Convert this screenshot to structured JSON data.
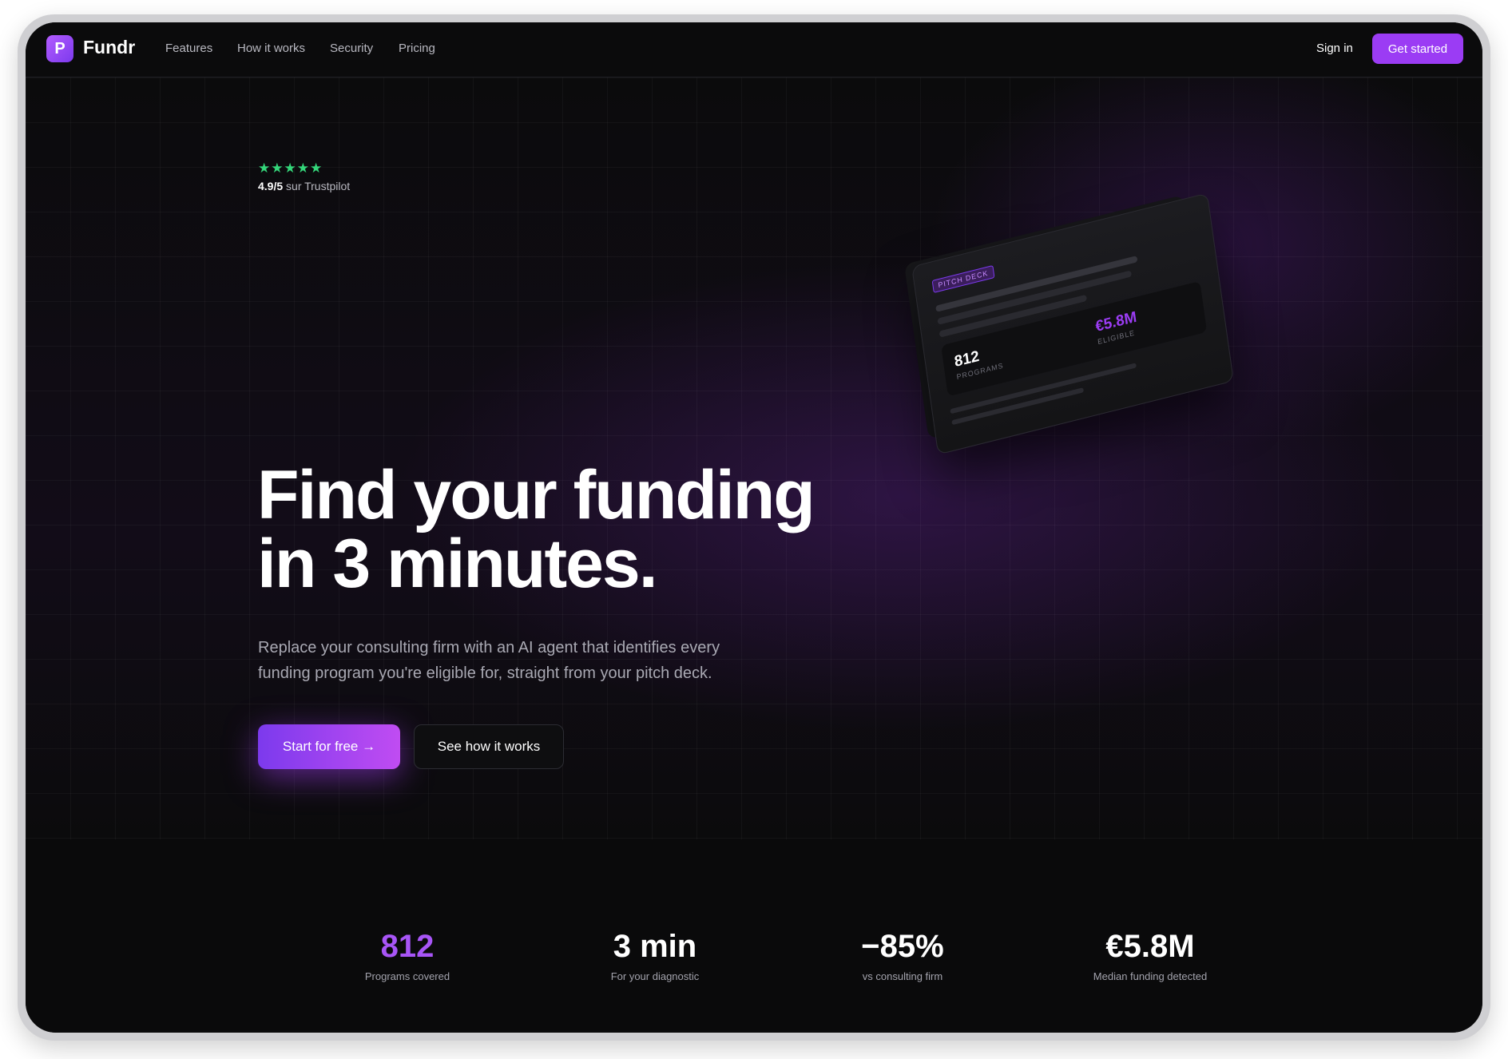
{
  "brand": {
    "mark": "P",
    "name": "Fundr",
    "accent": "#9b3cf4"
  },
  "nav": {
    "links": [
      "Features",
      "How it works",
      "Security",
      "Pricing"
    ],
    "signin": "Sign in",
    "cta": "Get started"
  },
  "rating": {
    "stars": "★★★★★",
    "score": "4.9/5",
    "source": "sur Trustpilot",
    "star_color": "#34d67a"
  },
  "hero": {
    "title_line1": "Find your funding",
    "title_line2": "in 3 minutes.",
    "subtitle": "Replace your consulting firm with an AI agent that identifies every funding program you're eligible for, straight from your pitch deck.",
    "primary_cta": "Start for free →",
    "secondary_cta": "See how it works"
  },
  "card": {
    "tag": "PITCH DECK",
    "programs_value": "812",
    "programs_label": "PROGRAMS",
    "eligible_value": "€5.8M",
    "eligible_label": "ELIGIBLE"
  },
  "stats": [
    {
      "value": "812",
      "label": "Programs covered",
      "accent": true
    },
    {
      "value": "3 min",
      "label": "For your diagnostic",
      "accent": false
    },
    {
      "value": "−85%",
      "label": "vs consulting firm",
      "accent": false
    },
    {
      "value": "€5.8M",
      "label": "Median funding detected",
      "accent": false
    }
  ]
}
